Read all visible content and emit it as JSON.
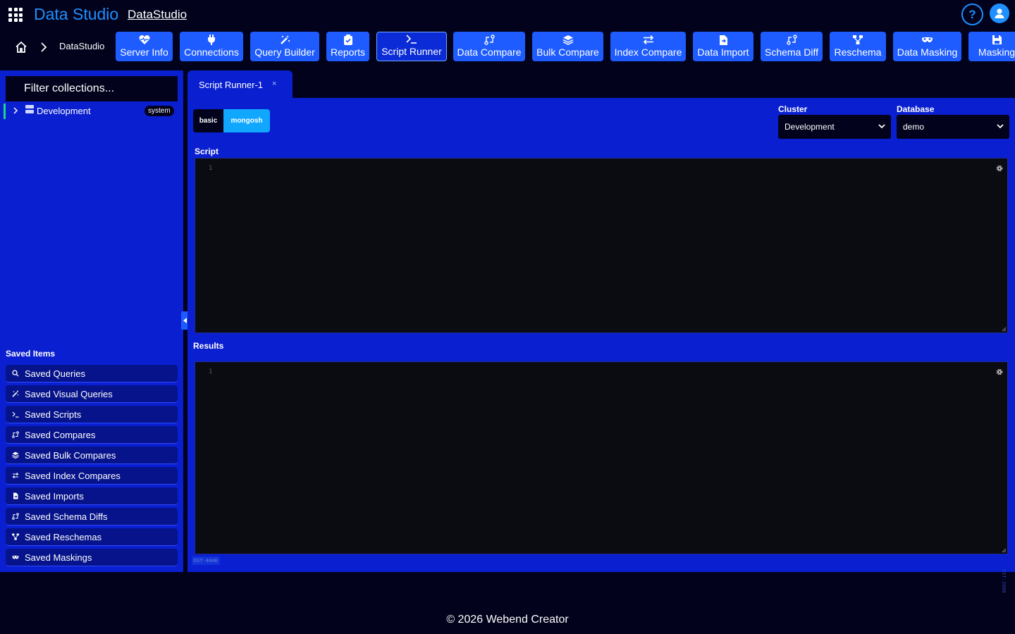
{
  "app": {
    "title": "Data Studio",
    "link": "DataStudio"
  },
  "header": {
    "help_label": "?"
  },
  "breadcrumb": {
    "current": "DataStudio"
  },
  "toolbar": {
    "items": [
      {
        "label": "Server Info",
        "icon": "heart-pulse-icon"
      },
      {
        "label": "Connections",
        "icon": "plug-icon"
      },
      {
        "label": "Query Builder",
        "icon": "magic-wand-icon"
      },
      {
        "label": "Reports",
        "icon": "clipboard-check-icon"
      },
      {
        "label": "Script Runner",
        "icon": "terminal-icon",
        "active": true
      },
      {
        "label": "Data Compare",
        "icon": "compare-icon"
      },
      {
        "label": "Bulk Compare",
        "icon": "layers-icon"
      },
      {
        "label": "Index Compare",
        "icon": "arrows-swap-icon"
      },
      {
        "label": "Data Import",
        "icon": "file-import-icon"
      },
      {
        "label": "Schema Diff",
        "icon": "compare-icon"
      },
      {
        "label": "Reschema",
        "icon": "diagram-icon"
      },
      {
        "label": "Data Masking",
        "icon": "mask-icon"
      },
      {
        "label": "Masking",
        "icon": "save-icon"
      }
    ]
  },
  "sidebar": {
    "filter_placeholder": "Filter collections...",
    "tree": [
      {
        "label": "Development",
        "badge": "system"
      }
    ],
    "saved_heading": "Saved Items",
    "saved_items": [
      {
        "label": "Saved Queries",
        "icon": "search-icon"
      },
      {
        "label": "Saved Visual Queries",
        "icon": "magic-wand-icon"
      },
      {
        "label": "Saved Scripts",
        "icon": "terminal-icon"
      },
      {
        "label": "Saved Compares",
        "icon": "compare-icon"
      },
      {
        "label": "Saved Bulk Compares",
        "icon": "layers-icon"
      },
      {
        "label": "Saved Index Compares",
        "icon": "arrows-swap-icon"
      },
      {
        "label": "Saved Imports",
        "icon": "file-import-icon"
      },
      {
        "label": "Saved Schema Diffs",
        "icon": "compare-icon"
      },
      {
        "label": "Saved Reschemas",
        "icon": "diagram-icon"
      },
      {
        "label": "Saved Maskings",
        "icon": "mask-icon"
      }
    ]
  },
  "main": {
    "tab_label": "Script Runner-1",
    "tab_close": "×",
    "mode": {
      "basic": "basic",
      "mongosh": "mongosh"
    },
    "cluster_label": "Cluster",
    "cluster_value": "Development",
    "database_label": "Database",
    "database_value": "demo",
    "script_label": "Script",
    "results_label": "Results",
    "script_line": "1",
    "results_line": "1",
    "tag": "DST-4046",
    "side_tag": "DST-2000"
  },
  "footer": {
    "text": "© 2026 Webend Creator"
  },
  "colors": {
    "accent": "#1e90ff",
    "panel": "#0a1fd0",
    "button": "#1e5cff",
    "background": "#02021c"
  }
}
